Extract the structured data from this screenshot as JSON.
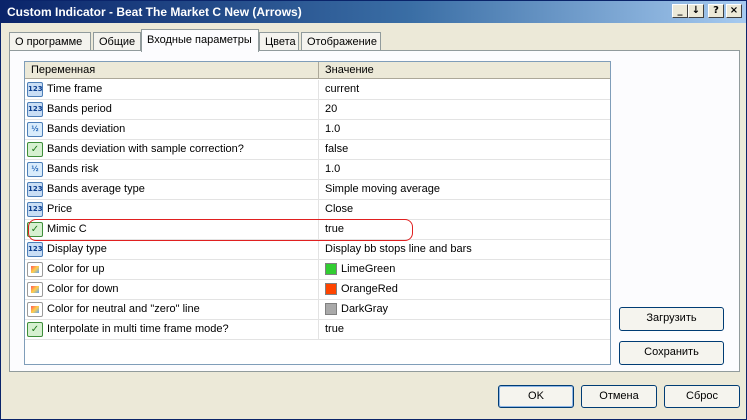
{
  "window": {
    "title": "Custom Indicator - Beat The Market C New (Arrows)",
    "buttons": {
      "minimize": "_",
      "maximize": "↓",
      "help": "?",
      "close": "×"
    }
  },
  "tabs": [
    {
      "label": "О программе"
    },
    {
      "label": "Общие"
    },
    {
      "label": "Входные параметры"
    },
    {
      "label": "Цвета"
    },
    {
      "label": "Отображение"
    }
  ],
  "active_tab": "Входные параметры",
  "grid": {
    "headers": {
      "variable": "Переменная",
      "value": "Значение"
    },
    "rows": [
      {
        "icon": "int-icon",
        "icon_text": "123",
        "name": "Time frame",
        "value": "current"
      },
      {
        "icon": "int-icon",
        "icon_text": "123",
        "name": "Bands period",
        "value": "20"
      },
      {
        "icon": "double-icon",
        "icon_text": "½",
        "name": "Bands deviation",
        "value": "1.0"
      },
      {
        "icon": "bool-icon",
        "icon_text": "✓",
        "name": "Bands deviation with sample correction?",
        "value": "false"
      },
      {
        "icon": "double-icon",
        "icon_text": "½",
        "name": "Bands risk",
        "value": "1.0"
      },
      {
        "icon": "int-icon",
        "icon_text": "123",
        "name": "Bands average type",
        "value": "Simple moving average"
      },
      {
        "icon": "int-icon",
        "icon_text": "123",
        "name": "Price",
        "value": "Close"
      },
      {
        "icon": "bool-icon",
        "icon_text": "✓",
        "name": "Mimic C",
        "value": "true",
        "highlighted": true
      },
      {
        "icon": "int-icon",
        "icon_text": "123",
        "name": "Display type",
        "value": "Display bb stops line and bars"
      },
      {
        "icon": "color-icon",
        "icon_text": "",
        "name": "Color for up",
        "value": "LimeGreen",
        "swatch": "#32cd32"
      },
      {
        "icon": "color-icon",
        "icon_text": "",
        "name": "Color for down",
        "value": "OrangeRed",
        "swatch": "#ff4500"
      },
      {
        "icon": "color-icon",
        "icon_text": "",
        "name": "Color for neutral and \"zero\" line",
        "value": "DarkGray",
        "swatch": "#a9a9a9"
      },
      {
        "icon": "bool-icon",
        "icon_text": "✓",
        "name": "Interpolate in multi time frame mode?",
        "value": "true"
      }
    ]
  },
  "side_buttons": {
    "load": "Загрузить",
    "save": "Сохранить"
  },
  "footer_buttons": {
    "ok": "OK",
    "cancel": "Отмена",
    "reset": "Сброс"
  },
  "colors": {
    "titlebar": "#0a246a",
    "highlight_outline": "#e02020"
  }
}
